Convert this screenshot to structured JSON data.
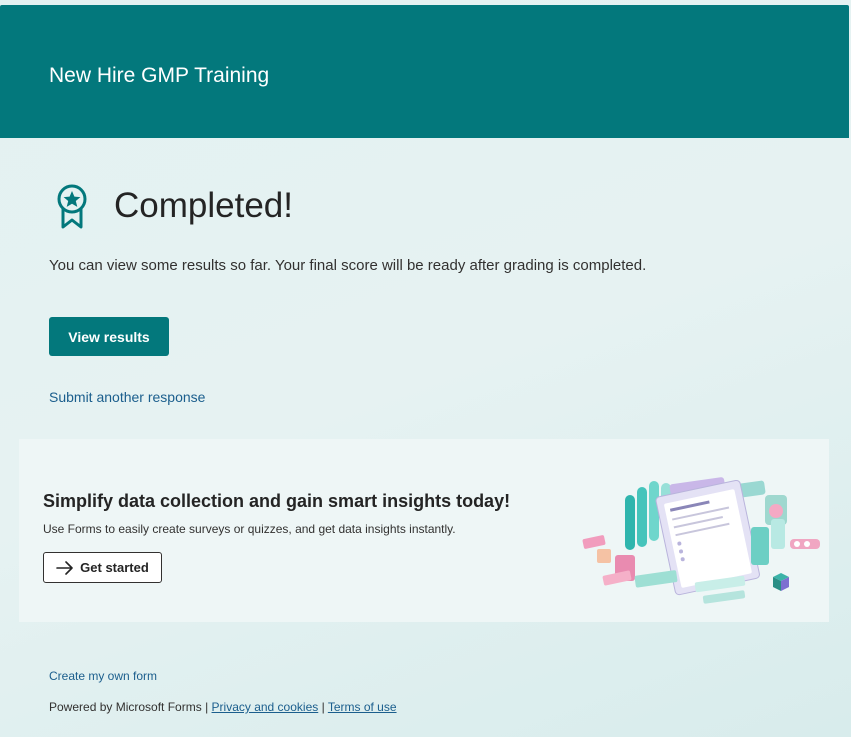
{
  "header": {
    "title": "New Hire GMP Training"
  },
  "status": {
    "icon": "ribbon-star-icon",
    "title": "Completed!",
    "message": "You can view some results so far. Your final score will be ready after grading is completed."
  },
  "actions": {
    "view_results_label": "View results",
    "submit_another_label": "Submit another response"
  },
  "promo": {
    "title": "Simplify data collection and gain smart insights today!",
    "subtitle": "Use Forms to easily create surveys or quizzes, and get data insights instantly.",
    "get_started_label": "Get started",
    "get_started_icon": "arrow-right-icon",
    "illustration_icon": "forms-illustration"
  },
  "footer": {
    "create_form_label": "Create my own form",
    "powered_by": "Powered by Microsoft Forms",
    "separator": "|",
    "privacy_label": "Privacy and cookies",
    "terms_label": "Terms of use"
  },
  "colors": {
    "brand": "#03787c",
    "link": "#1b5e8d",
    "text": "#242424"
  }
}
